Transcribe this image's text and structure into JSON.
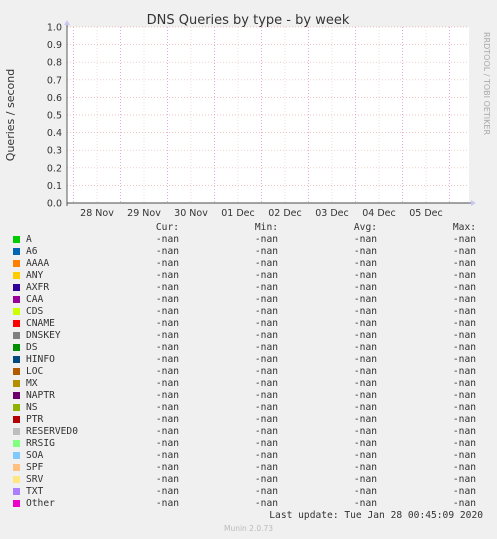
{
  "chart_data": {
    "type": "line",
    "title": "DNS Queries by type - by week",
    "ylabel": "Queries / second",
    "xlabel": "",
    "ylim": [
      0,
      1.0
    ],
    "yticks": [
      "0.0",
      "0.1",
      "0.2",
      "0.3",
      "0.4",
      "0.5",
      "0.6",
      "0.7",
      "0.8",
      "0.9",
      "1.0"
    ],
    "categories": [
      "28 Nov",
      "29 Nov",
      "30 Nov",
      "01 Dec",
      "02 Dec",
      "03 Dec",
      "04 Dec",
      "05 Dec"
    ],
    "grid": true,
    "series": [
      {
        "name": "A",
        "values": []
      },
      {
        "name": "A6",
        "values": []
      },
      {
        "name": "AAAA",
        "values": []
      },
      {
        "name": "ANY",
        "values": []
      },
      {
        "name": "AXFR",
        "values": []
      },
      {
        "name": "CAA",
        "values": []
      },
      {
        "name": "CDS",
        "values": []
      },
      {
        "name": "CNAME",
        "values": []
      },
      {
        "name": "DNSKEY",
        "values": []
      },
      {
        "name": "DS",
        "values": []
      },
      {
        "name": "HINFO",
        "values": []
      },
      {
        "name": "LOC",
        "values": []
      },
      {
        "name": "MX",
        "values": []
      },
      {
        "name": "NAPTR",
        "values": []
      },
      {
        "name": "NS",
        "values": []
      },
      {
        "name": "PTR",
        "values": []
      },
      {
        "name": "RESERVED0",
        "values": []
      },
      {
        "name": "RRSIG",
        "values": []
      },
      {
        "name": "SOA",
        "values": []
      },
      {
        "name": "SPF",
        "values": []
      },
      {
        "name": "SRV",
        "values": []
      },
      {
        "name": "TXT",
        "values": []
      },
      {
        "name": "Other",
        "values": []
      }
    ]
  },
  "side_label": "RRDTOOL / TOBI OETIKER",
  "legend": {
    "headers": {
      "cur": "Cur:",
      "min": "Min:",
      "avg": "Avg:",
      "max": "Max:"
    },
    "rows": [
      {
        "name": "A",
        "color": "#00cc00",
        "cur": "-nan",
        "min": "-nan",
        "avg": "-nan",
        "max": "-nan"
      },
      {
        "name": "A6",
        "color": "#0066b3",
        "cur": "-nan",
        "min": "-nan",
        "avg": "-nan",
        "max": "-nan"
      },
      {
        "name": "AAAA",
        "color": "#ff8000",
        "cur": "-nan",
        "min": "-nan",
        "avg": "-nan",
        "max": "-nan"
      },
      {
        "name": "ANY",
        "color": "#ffcc00",
        "cur": "-nan",
        "min": "-nan",
        "avg": "-nan",
        "max": "-nan"
      },
      {
        "name": "AXFR",
        "color": "#330099",
        "cur": "-nan",
        "min": "-nan",
        "avg": "-nan",
        "max": "-nan"
      },
      {
        "name": "CAA",
        "color": "#990099",
        "cur": "-nan",
        "min": "-nan",
        "avg": "-nan",
        "max": "-nan"
      },
      {
        "name": "CDS",
        "color": "#ccff00",
        "cur": "-nan",
        "min": "-nan",
        "avg": "-nan",
        "max": "-nan"
      },
      {
        "name": "CNAME",
        "color": "#ff0000",
        "cur": "-nan",
        "min": "-nan",
        "avg": "-nan",
        "max": "-nan"
      },
      {
        "name": "DNSKEY",
        "color": "#808080",
        "cur": "-nan",
        "min": "-nan",
        "avg": "-nan",
        "max": "-nan"
      },
      {
        "name": "DS",
        "color": "#008f00",
        "cur": "-nan",
        "min": "-nan",
        "avg": "-nan",
        "max": "-nan"
      },
      {
        "name": "HINFO",
        "color": "#00487d",
        "cur": "-nan",
        "min": "-nan",
        "avg": "-nan",
        "max": "-nan"
      },
      {
        "name": "LOC",
        "color": "#b35a00",
        "cur": "-nan",
        "min": "-nan",
        "avg": "-nan",
        "max": "-nan"
      },
      {
        "name": "MX",
        "color": "#b38f00",
        "cur": "-nan",
        "min": "-nan",
        "avg": "-nan",
        "max": "-nan"
      },
      {
        "name": "NAPTR",
        "color": "#6b006b",
        "cur": "-nan",
        "min": "-nan",
        "avg": "-nan",
        "max": "-nan"
      },
      {
        "name": "NS",
        "color": "#8fb300",
        "cur": "-nan",
        "min": "-nan",
        "avg": "-nan",
        "max": "-nan"
      },
      {
        "name": "PTR",
        "color": "#b30000",
        "cur": "-nan",
        "min": "-nan",
        "avg": "-nan",
        "max": "-nan"
      },
      {
        "name": "RESERVED0",
        "color": "#bebebe",
        "cur": "-nan",
        "min": "-nan",
        "avg": "-nan",
        "max": "-nan"
      },
      {
        "name": "RRSIG",
        "color": "#80ff80",
        "cur": "-nan",
        "min": "-nan",
        "avg": "-nan",
        "max": "-nan"
      },
      {
        "name": "SOA",
        "color": "#80c9ff",
        "cur": "-nan",
        "min": "-nan",
        "avg": "-nan",
        "max": "-nan"
      },
      {
        "name": "SPF",
        "color": "#ffc080",
        "cur": "-nan",
        "min": "-nan",
        "avg": "-nan",
        "max": "-nan"
      },
      {
        "name": "SRV",
        "color": "#ffe680",
        "cur": "-nan",
        "min": "-nan",
        "avg": "-nan",
        "max": "-nan"
      },
      {
        "name": "TXT",
        "color": "#aa80ff",
        "cur": "-nan",
        "min": "-nan",
        "avg": "-nan",
        "max": "-nan"
      },
      {
        "name": "Other",
        "color": "#ee00cc",
        "cur": "-nan",
        "min": "-nan",
        "avg": "-nan",
        "max": "-nan"
      }
    ]
  },
  "footer": {
    "last_update": "Last update: Tue Jan 28 00:45:09 2020",
    "munin": "Munin 2.0.73"
  }
}
